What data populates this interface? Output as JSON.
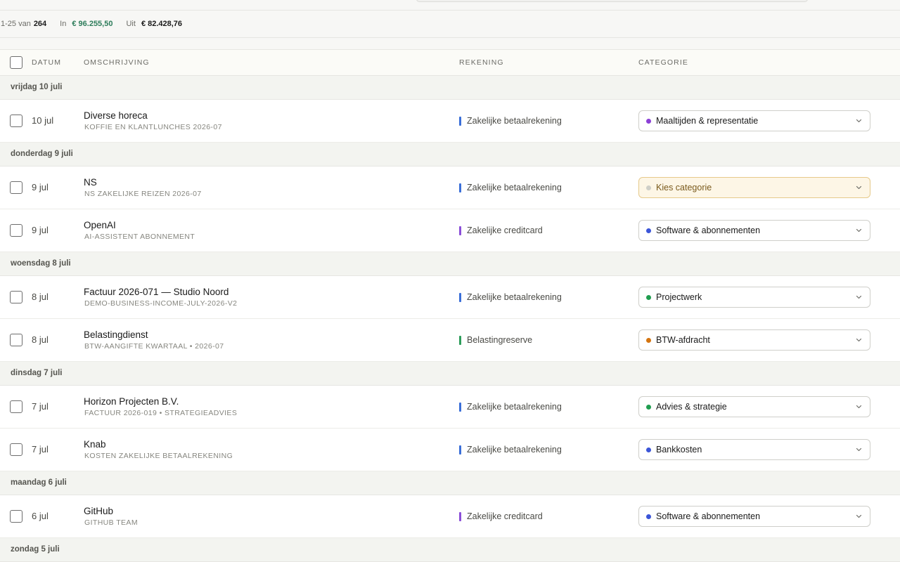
{
  "summary": {
    "range": "1-25 van",
    "total": "264",
    "in_label": "In",
    "in_value": "€ 96.255,50",
    "out_label": "Uit",
    "out_value": "€ 82.428,76"
  },
  "table": {
    "columns": {
      "date": "DATUM",
      "description": "OMSCHRIJVING",
      "account": "REKENING",
      "category": "CATEGORIE"
    }
  },
  "colors": {
    "accent_green": "#2e7d5b",
    "account_betaal": "#3b6fd8",
    "account_credit": "#8b4fd8",
    "account_reserve": "#2e9d5b"
  },
  "groups": [
    {
      "label": "vrijdag 10 juli",
      "rows": [
        {
          "date": "10 jul",
          "title": "Diverse horeca",
          "sub": "KOFFIE EN KLANTLUNCHES 2026-07",
          "account": "Zakelijke betaalrekening",
          "account_color": "#3b6fd8",
          "category": "Maaltijden & representatie",
          "category_color": "#8b3fd6",
          "empty": false
        }
      ]
    },
    {
      "label": "donderdag 9 juli",
      "rows": [
        {
          "date": "9 jul",
          "title": "NS",
          "sub": "NS ZAKELIJKE REIZEN 2026-07",
          "account": "Zakelijke betaalrekening",
          "account_color": "#3b6fd8",
          "category": "Kies categorie",
          "category_color": "#cfcfc8",
          "empty": true
        },
        {
          "date": "9 jul",
          "title": "OpenAI",
          "sub": "AI-ASSISTENT ABONNEMENT",
          "account": "Zakelijke creditcard",
          "account_color": "#8b4fd8",
          "category": "Software & abonnementen",
          "category_color": "#3b55d8",
          "empty": false
        }
      ]
    },
    {
      "label": "woensdag 8 juli",
      "rows": [
        {
          "date": "8 jul",
          "title": "Factuur 2026-071 — Studio Noord",
          "sub": "DEMO-BUSINESS-INCOME-JULY-2026-V2",
          "account": "Zakelijke betaalrekening",
          "account_color": "#3b6fd8",
          "category": "Projectwerk",
          "category_color": "#1f9d4f",
          "empty": false
        },
        {
          "date": "8 jul",
          "title": "Belastingdienst",
          "sub": "BTW-AANGIFTE KWARTAAL • 2026-07",
          "account": "Belastingreserve",
          "account_color": "#2e9d5b",
          "category": "BTW-afdracht",
          "category_color": "#d4740f",
          "empty": false
        }
      ]
    },
    {
      "label": "dinsdag 7 juli",
      "rows": [
        {
          "date": "7 jul",
          "title": "Horizon Projecten B.V.",
          "sub": "FACTUUR 2026-019 • STRATEGIEADVIES",
          "account": "Zakelijke betaalrekening",
          "account_color": "#3b6fd8",
          "category": "Advies & strategie",
          "category_color": "#1f9d4f",
          "empty": false
        },
        {
          "date": "7 jul",
          "title": "Knab",
          "sub": "KOSTEN ZAKELIJKE BETAALREKENING",
          "account": "Zakelijke betaalrekening",
          "account_color": "#3b6fd8",
          "category": "Bankkosten",
          "category_color": "#3b55d8",
          "empty": false
        }
      ]
    },
    {
      "label": "maandag 6 juli",
      "rows": [
        {
          "date": "6 jul",
          "title": "GitHub",
          "sub": "GITHUB TEAM",
          "account": "Zakelijke creditcard",
          "account_color": "#8b4fd8",
          "category": "Software & abonnementen",
          "category_color": "#3b55d8",
          "empty": false
        }
      ]
    },
    {
      "label": "zondag 5 juli",
      "rows": []
    }
  ]
}
